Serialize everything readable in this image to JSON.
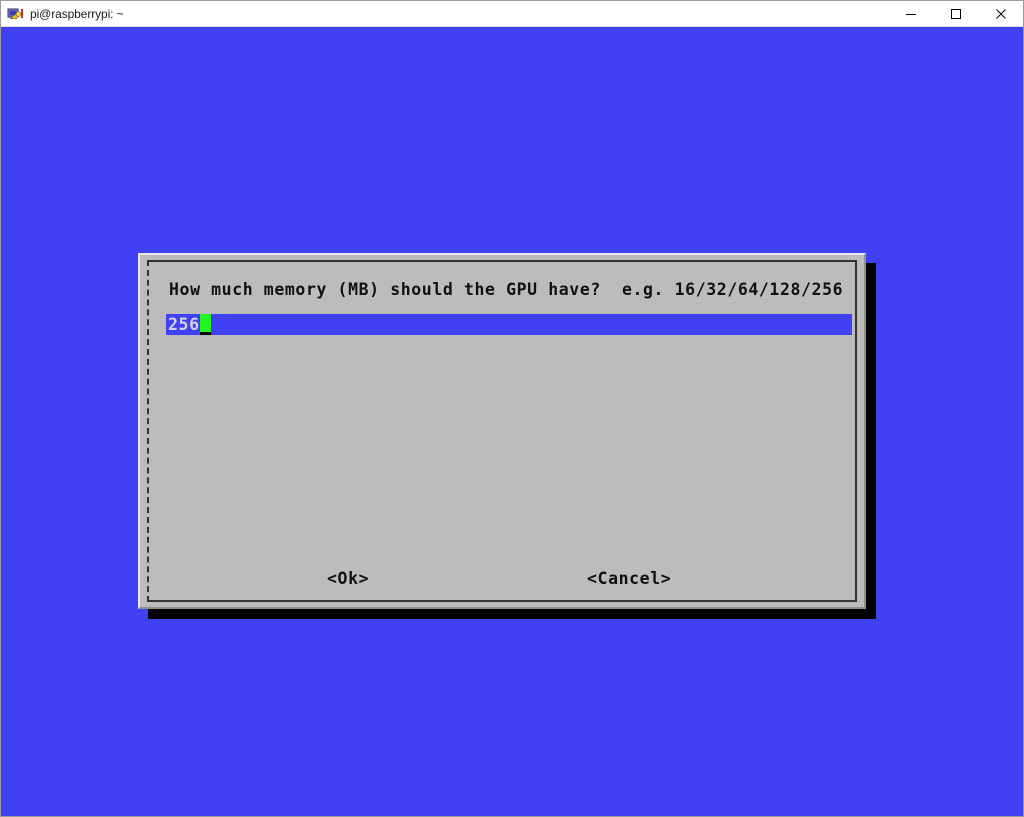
{
  "window": {
    "title": "pi@raspberrypi: ~",
    "icon": "putty-terminal-icon",
    "controls": [
      {
        "name": "minimize-button",
        "glyph": "minimize-icon",
        "label": "Minimize"
      },
      {
        "name": "maximize-button",
        "glyph": "maximize-icon",
        "label": "Maximize"
      },
      {
        "name": "close-button",
        "glyph": "close-icon",
        "label": "Close"
      }
    ]
  },
  "terminal": {
    "background_color": "#4040f5",
    "foreground_color": "#d3d3e8"
  },
  "dialog": {
    "type": "whiptail-inputbox",
    "background_color": "#bcbcbc",
    "border_color": "#333333",
    "shadow_color": "#000000",
    "prompt": "How much memory (MB) should the GPU have?  e.g. 16/32/64/128/256",
    "input": {
      "value": "256",
      "placeholder": "",
      "field_color": "#4040f5",
      "text_color": "#d3d3e8",
      "cursor_color": "#22f522"
    },
    "buttons": [
      {
        "name": "ok-button",
        "label": "<Ok>"
      },
      {
        "name": "cancel-button",
        "label": "<Cancel>"
      }
    ]
  }
}
